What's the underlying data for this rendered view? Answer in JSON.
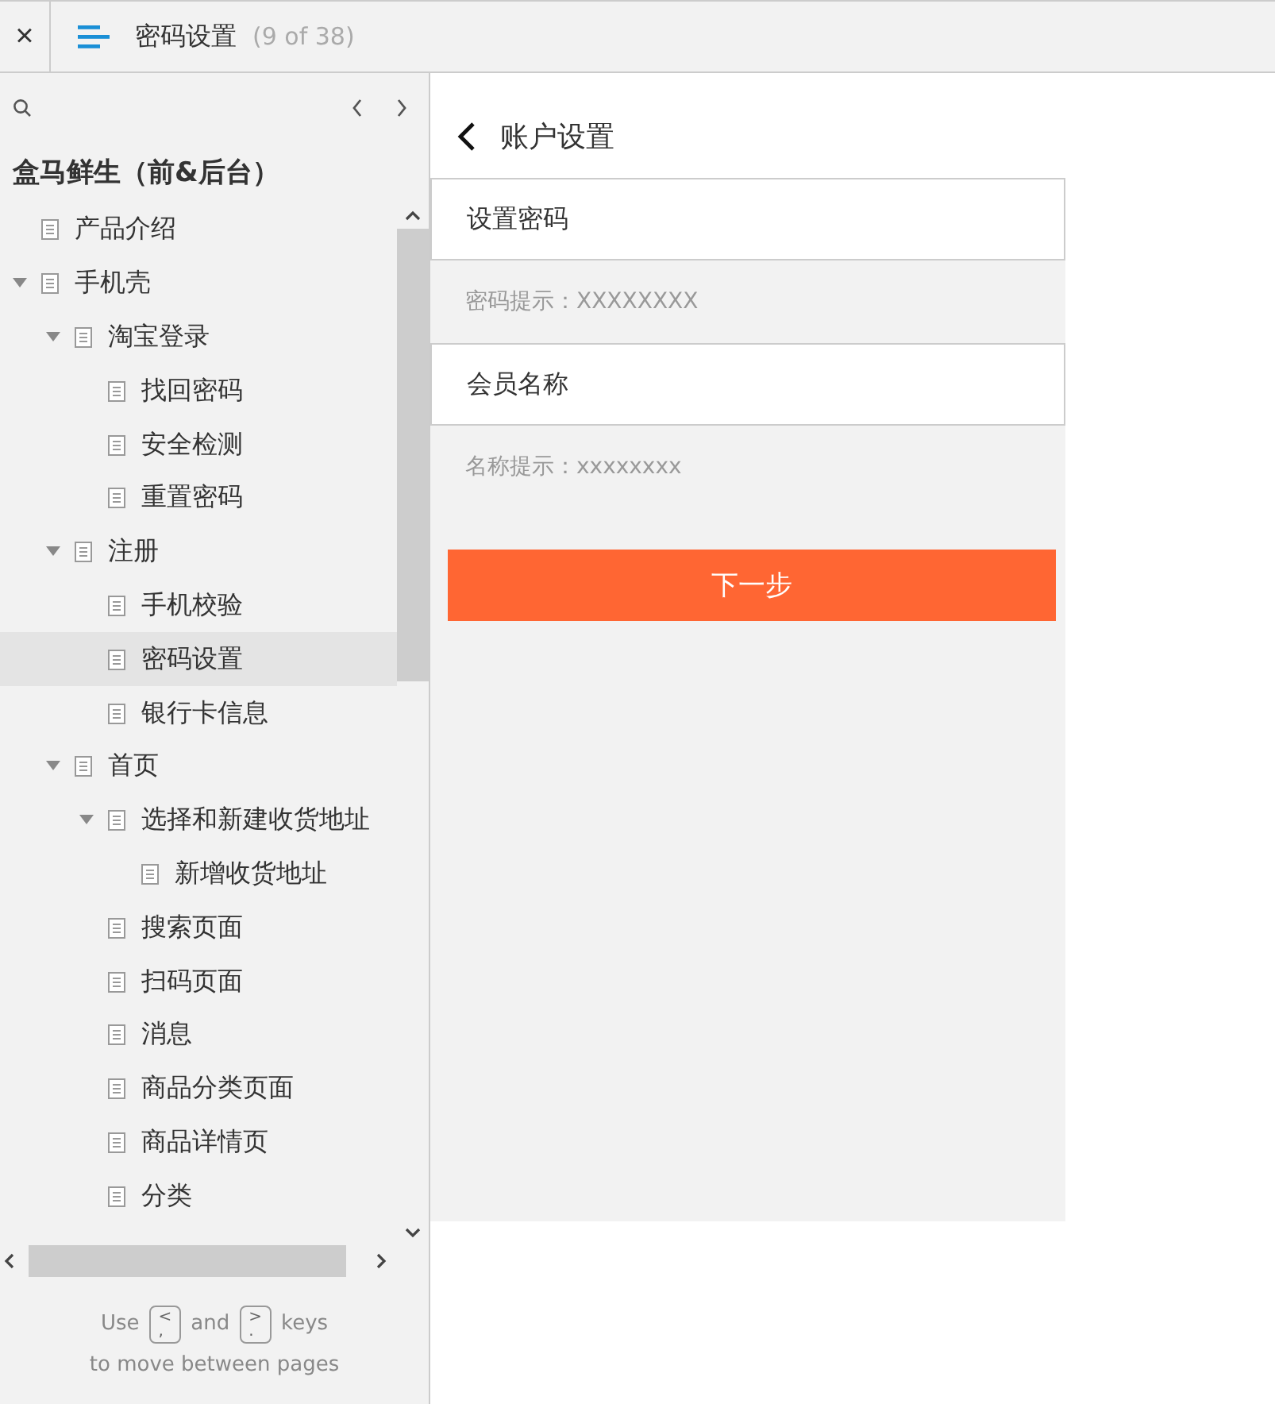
{
  "toolbar": {
    "close": "×",
    "page_title": "密码设置",
    "page_count": "(9 of 38)"
  },
  "sidebar": {
    "project_title": "盒马鲜生（前&后台）",
    "tree": [
      {
        "label": "产品介绍",
        "selected": false
      },
      {
        "label": "手机壳",
        "expanded": true,
        "selected": false,
        "children": [
          {
            "label": "淘宝登录",
            "expanded": true,
            "selected": false,
            "children": [
              {
                "label": "找回密码",
                "selected": false
              },
              {
                "label": "安全检测",
                "selected": false
              },
              {
                "label": "重置密码",
                "selected": false
              }
            ]
          },
          {
            "label": "注册",
            "expanded": true,
            "selected": false,
            "children": [
              {
                "label": "手机校验",
                "selected": false
              },
              {
                "label": "密码设置",
                "selected": true
              },
              {
                "label": "银行卡信息",
                "selected": false
              }
            ]
          },
          {
            "label": "首页",
            "expanded": true,
            "selected": false,
            "children": [
              {
                "label": "选择和新建收货地址",
                "expanded": true,
                "selected": false,
                "children": [
                  {
                    "label": "新增收货地址",
                    "selected": false
                  }
                ]
              },
              {
                "label": "搜索页面",
                "selected": false
              },
              {
                "label": "扫码页面",
                "selected": false
              },
              {
                "label": "消息",
                "selected": false
              },
              {
                "label": "商品分类页面",
                "selected": false
              },
              {
                "label": "商品详情页",
                "selected": false
              },
              {
                "label": "分类",
                "selected": false
              }
            ]
          }
        ]
      }
    ],
    "footer": {
      "use": "Use",
      "key_prev": [
        "<",
        ","
      ],
      "and": "and",
      "key_next": [
        ">",
        "."
      ],
      "keys": "keys",
      "line2": "to move between pages"
    }
  },
  "screen": {
    "title": "账户设置",
    "fields": [
      {
        "label": "设置密码",
        "hint": "密码提示：XXXXXXXX"
      },
      {
        "label": "会员名称",
        "hint": "名称提示：xxxxxxxx"
      }
    ],
    "button": "下一步"
  }
}
